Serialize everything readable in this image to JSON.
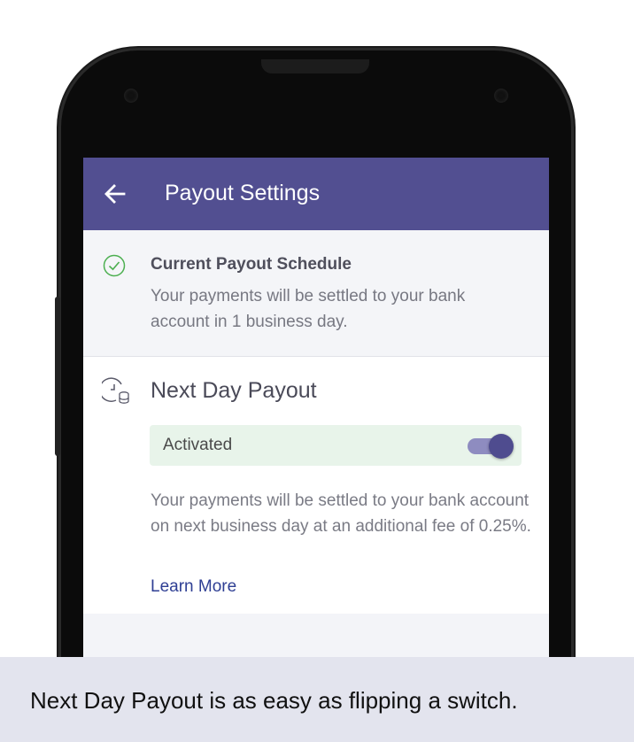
{
  "appbar": {
    "title": "Payout Settings",
    "back_icon": "arrow-left-icon",
    "color": "#524f91"
  },
  "current_schedule": {
    "icon": "check-circle-icon",
    "title": "Current Payout Schedule",
    "description": "Your payments will be settled to your bank account in 1 business day."
  },
  "next_day_payout": {
    "icon": "clock-coins-icon",
    "title": "Next Day Payout",
    "status_label": "Activated",
    "toggle_on": true,
    "description": "Your payments will be settled to your bank account on next business day at an additional fee of 0.25%.",
    "learn_more": "Learn More"
  },
  "caption": "Next Day Payout is as easy as flipping a switch.",
  "colors": {
    "accent": "#524f91",
    "success": "#4caf50",
    "link": "#2f3f94",
    "activated_bg": "#e8f4ea"
  }
}
